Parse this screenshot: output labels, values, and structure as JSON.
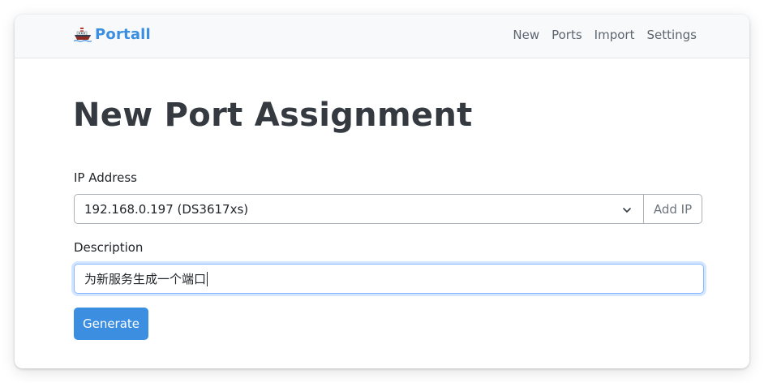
{
  "navbar": {
    "brand": {
      "icon": "ship-icon",
      "text": "Portall"
    },
    "links": [
      {
        "label": "New"
      },
      {
        "label": "Ports"
      },
      {
        "label": "Import"
      },
      {
        "label": "Settings"
      }
    ]
  },
  "main": {
    "title": "New Port Assignment",
    "ip_field": {
      "label": "IP Address",
      "selected_value": "192.168.0.197 (DS3617xs)",
      "add_button": "Add IP"
    },
    "description_field": {
      "label": "Description",
      "value": "为新服务生成一个端口"
    },
    "generate_button": "Generate"
  },
  "colors": {
    "brand_accent": "#3b8ee0",
    "navbar_bg": "#f8f9fa",
    "title_text": "#343a40",
    "focus_border": "#86b7fe"
  }
}
